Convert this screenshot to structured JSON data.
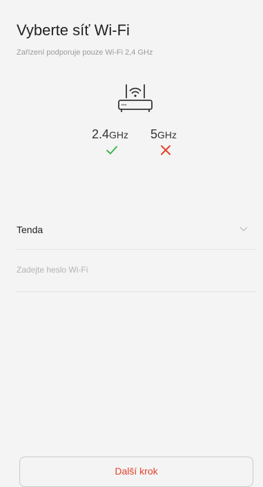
{
  "header": {
    "title": "Vyberte síť Wi-Fi",
    "subtitle": "Zařízení podporuje pouze Wi-Fi 2,4 GHz"
  },
  "bands": [
    {
      "value": "2.4",
      "unit": "GHz",
      "supported": true,
      "status_icon": "check-icon",
      "status_color": "#3cb44a"
    },
    {
      "value": "5",
      "unit": "GHz",
      "supported": false,
      "status_icon": "cross-icon",
      "status_color": "#e0412b"
    }
  ],
  "icons": {
    "router": "router-wifi-icon",
    "dropdown": "chevron-down-icon"
  },
  "form": {
    "ssid_value": "Tenda",
    "password_value": "",
    "password_placeholder": "Zadejte heslo Wi-Fi"
  },
  "footer": {
    "next_label": "Další krok"
  },
  "colors": {
    "background": "#f4f4f4",
    "accent": "#e0412b",
    "success": "#3cb44a",
    "divider": "#e2e2e2"
  }
}
